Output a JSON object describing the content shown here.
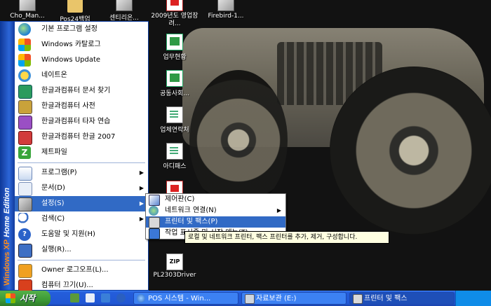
{
  "desktop": {
    "icons": [
      {
        "label": "Cho_Man...",
        "icon": "app-icon"
      },
      {
        "label": "Pos24백업",
        "icon": "folder-icon"
      },
      {
        "label": "센티리온...",
        "icon": "app-icon"
      },
      {
        "label": "2009년도 영업장려...",
        "icon": "pdf-icon"
      },
      {
        "label": "Firebird-1...",
        "icon": "app-icon"
      },
      {
        "label": "업무현황",
        "icon": "excel-icon"
      },
      {
        "label": "공동사회...",
        "icon": "excel-icon"
      },
      {
        "label": "업체연락처",
        "icon": "document-icon"
      },
      {
        "label": "아디패스",
        "icon": "document-icon"
      },
      {
        "label": "PL2303Driver",
        "icon": "zip-icon"
      }
    ]
  },
  "start_menu": {
    "edition_text": "Windows XP",
    "edition_suffix": "Home Edition",
    "pinned": [
      {
        "label": "기본 프로그램 설정",
        "icon": "default-programs-icon"
      },
      {
        "label": "Windows 카탈로그",
        "icon": "windows-catalog-icon"
      },
      {
        "label": "Windows Update",
        "icon": "windows-update-icon"
      },
      {
        "label": "네이트온",
        "icon": "nateon-icon"
      },
      {
        "label": "한글과컴퓨터 문서 찾기",
        "icon": "hancom-find-icon"
      },
      {
        "label": "한글과컴퓨터 사전",
        "icon": "hancom-dictionary-icon"
      },
      {
        "label": "한글과컴퓨터 타자 연습",
        "icon": "hancom-typing-icon"
      },
      {
        "label": "한글과컴퓨터 한글 2007",
        "icon": "hangul-2007-icon"
      },
      {
        "label": "제트파일",
        "icon": "zetfile-icon"
      }
    ],
    "system": [
      {
        "label": "프로그램(P)",
        "icon": "programs-icon",
        "has_submenu": true
      },
      {
        "label": "문서(D)",
        "icon": "documents-icon",
        "has_submenu": true
      },
      {
        "label": "설정(S)",
        "icon": "settings-icon",
        "has_submenu": true,
        "highlighted": true
      },
      {
        "label": "검색(C)",
        "icon": "search-icon",
        "has_submenu": true
      },
      {
        "label": "도움말 및 지원(H)",
        "icon": "help-icon"
      },
      {
        "label": "실행(R)...",
        "icon": "run-icon"
      }
    ],
    "session": [
      {
        "label": "Owner 로그오프(L)...",
        "icon": "logoff-icon"
      },
      {
        "label": "컴퓨터 끄기(U)...",
        "icon": "shutdown-icon"
      }
    ]
  },
  "settings_submenu": [
    {
      "label": "제어판(C)",
      "icon": "control-panel-icon"
    },
    {
      "label": "네트워크 연결(N)",
      "icon": "network-connections-icon",
      "has_submenu": true
    },
    {
      "label": "프린터 및 팩스(P)",
      "icon": "printers-faxes-icon",
      "highlighted": true
    },
    {
      "label": "작업 표시줄 및 시작 메뉴(T)",
      "icon": "taskbar-start-menu-icon"
    }
  ],
  "tooltip": "로컬 및 네트워크 프린터, 팩스 프린터를 추가, 제거, 구성합니다.",
  "taskbar": {
    "start_label": "시작",
    "tasks": [
      {
        "label": "POS 시스템 - Win...",
        "icon": "ie-icon"
      },
      {
        "label": "자료보관 (E:)",
        "icon": "drive-icon"
      },
      {
        "label": "프린터 및 팩스",
        "icon": "printers-faxes-icon"
      }
    ]
  }
}
